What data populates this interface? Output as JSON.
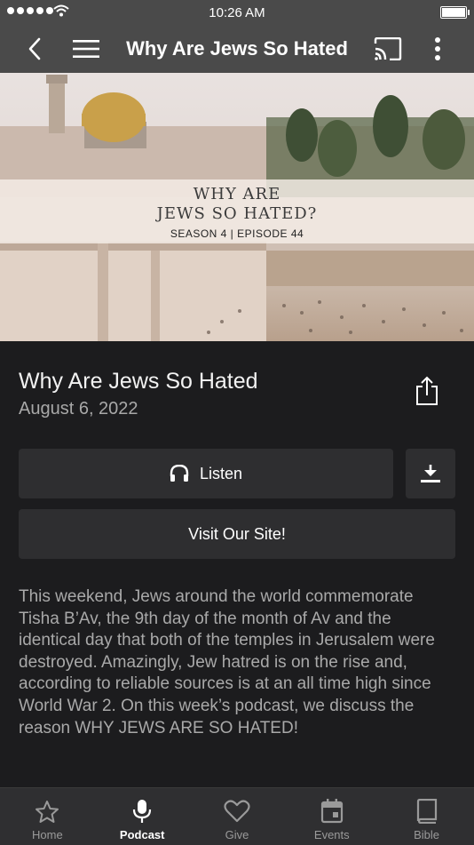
{
  "status_bar": {
    "time": "10:26 AM",
    "battery_level": 0.95
  },
  "nav": {
    "title": "Why Are Jews So Hated"
  },
  "hero": {
    "line1": "WHY ARE",
    "line2": "JEWS SO HATED?",
    "season_episode": "SEASON 4 | EPISODE 44"
  },
  "episode": {
    "title": "Why Are Jews So Hated",
    "date": "August 6, 2022"
  },
  "buttons": {
    "listen": "Listen",
    "visit": "Visit Our Site!"
  },
  "description": "This weekend, Jews around the world commemorate Tisha B’Av, the 9th day of the month of Av and the identical day that both of the temples in Jerusalem were destroyed. Amazingly, Jew hatred is on the rise and, according to reliable sources is at an all time high since World War 2. On this week’s podcast, we discuss the reason WHY JEWS ARE SO HATED!",
  "tabs": [
    {
      "label": "Home",
      "icon": "star-icon",
      "active": false
    },
    {
      "label": "Podcast",
      "icon": "microphone-icon",
      "active": true
    },
    {
      "label": "Give",
      "icon": "heart-icon",
      "active": false
    },
    {
      "label": "Events",
      "icon": "calendar-icon",
      "active": false
    },
    {
      "label": "Bible",
      "icon": "book-icon",
      "active": false
    }
  ],
  "colors": {
    "nav_bg": "#4a4a4a",
    "page_bg": "#1c1c1e",
    "button_bg": "#2e2e30",
    "tab_bar_bg": "#2f2f31"
  }
}
